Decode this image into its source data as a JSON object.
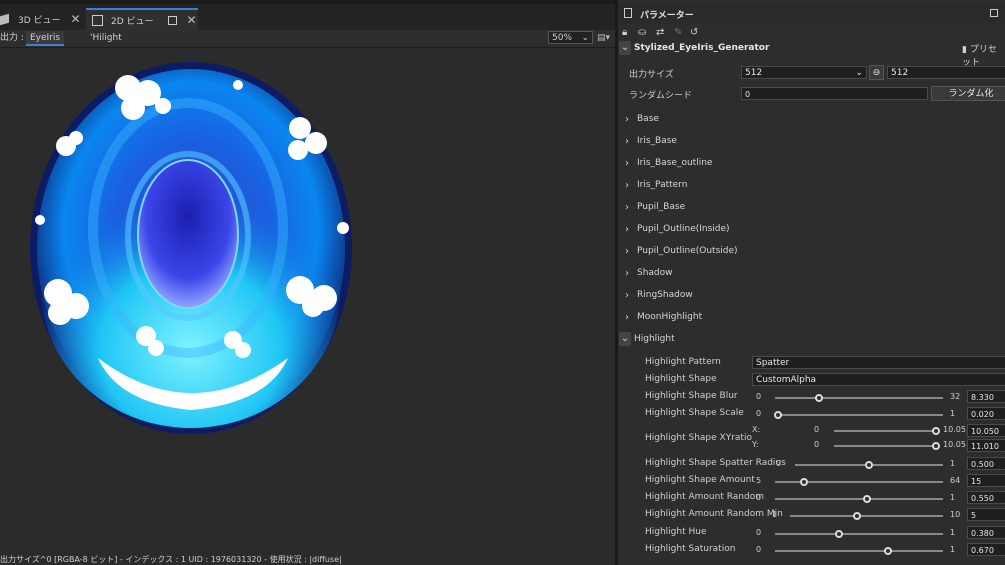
{
  "tabs": [
    {
      "label": "3D ビュー"
    },
    {
      "label": "2D ビュー"
    }
  ],
  "output_row": {
    "label": "出力 :",
    "output_name": "EyeIris",
    "channel": "'Hilight",
    "zoom": "50%"
  },
  "status_bar": "出力サイズ^0 [RGBA-8 ビット] - インデックス : 1 UID : 1976031320 - 使用状況 : |diffuse|",
  "panel": {
    "title": "パラメーター",
    "graph_name": "Stylized_EyeIris_Generator",
    "preset_label": "プリセット",
    "output_size_label": "出力サイズ",
    "output_size_w": "512",
    "output_size_h": "512",
    "seed_label": "ランダムシード",
    "seed_value": "0",
    "randomize_label": "ランダム化"
  },
  "sections": [
    "Base",
    "Iris_Base",
    "Iris_Base_outline",
    "Iris_Pattern",
    "Pupil_Base",
    "Pupil_Outline(Inside)",
    "Pupil_Outline(Outside)",
    "Shadow",
    "RingShadow",
    "MoonHighlight",
    "Highlight"
  ],
  "highlight": {
    "pattern_label": "Highlight Pattern",
    "pattern_value": "Spatter",
    "shape_label": "Highlight Shape",
    "shape_value": "CustomAlpha",
    "sliders": [
      {
        "label": "Highlight Shape Blur",
        "min": "0",
        "max": "32",
        "value": "8.330",
        "frac": 0.26
      },
      {
        "label": "Highlight Shape Scale",
        "min": "0",
        "max": "1",
        "value": "0.020",
        "frac": 0.02
      },
      {
        "label": "Highlight Shape Spatter Radius",
        "min": "0",
        "max": "1",
        "value": "0.500",
        "frac": 0.5
      },
      {
        "label": "Highlight Shape Amount",
        "min": "5",
        "max": "64",
        "value": "15",
        "frac": 0.17
      },
      {
        "label": "Highlight Amount Random",
        "min": "0",
        "max": "1",
        "value": "0.550",
        "frac": 0.55
      },
      {
        "label": "Highlight Amount Random Min",
        "min": "1",
        "max": "10",
        "value": "5",
        "frac": 0.44
      },
      {
        "label": "Highlight Hue",
        "min": "0",
        "max": "1",
        "value": "0.380",
        "frac": 0.38
      },
      {
        "label": "Highlight Saturation",
        "min": "0",
        "max": "1",
        "value": "0.670",
        "frac": 0.67
      }
    ],
    "xy": {
      "label": "Highlight Shape XYratio",
      "x_label": "X:",
      "y_label": "Y:",
      "x_min": "0",
      "x_max": "10.05",
      "x_value": "10.050",
      "x_frac": 1.0,
      "y_min": "0",
      "y_max": "10.05",
      "y_value": "11.010",
      "y_frac": 1.0
    }
  }
}
